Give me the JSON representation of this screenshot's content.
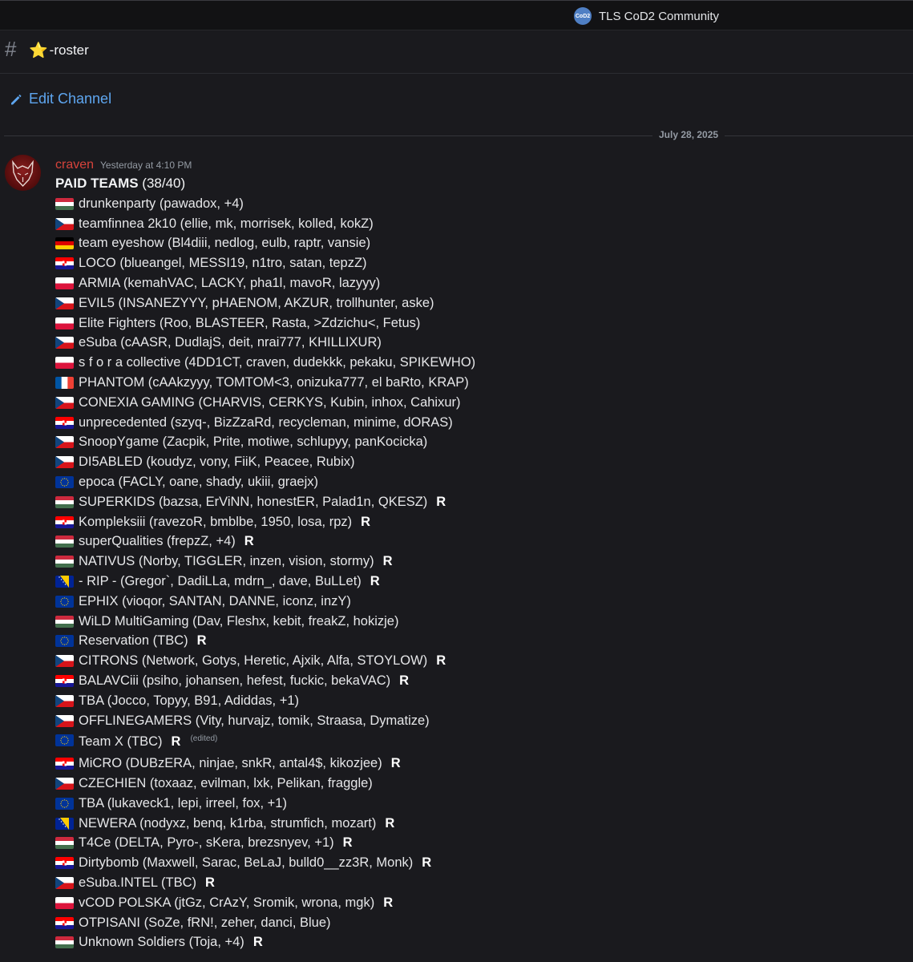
{
  "server": {
    "name": "TLS CoD2 Community",
    "icon_text": "CoD2"
  },
  "channel": {
    "hash_symbol": "#",
    "star": "⭐",
    "name": "-roster"
  },
  "edit_channel_label": "Edit Channel",
  "date_divider": "July 28, 2025",
  "message": {
    "author": "craven",
    "timestamp": "Yesterday at 4:10 PM",
    "title_bold": "PAID TEAMS",
    "title_count": " (38/40)",
    "r_mark": "R",
    "edited_label": "(edited)",
    "teams": [
      {
        "flag": "HU",
        "text": "drunkenparty (pawadox, +4)",
        "r": false
      },
      {
        "flag": "CZ",
        "text": "teamfinnea 2k10 (ellie, mk, morrisek, kolled, kokZ)",
        "r": false
      },
      {
        "flag": "DE",
        "text": "team eyeshow (Bl4diii, nedlog, eulb, raptr, vansie)",
        "r": false
      },
      {
        "flag": "HR",
        "text": "LOCO (blueangel, MESSI19, n1tro, satan, tepzZ)",
        "r": false
      },
      {
        "flag": "PL",
        "text": "ARMIA (kemahVAC, LACKY, pha1l, mavoR, lazyyy)",
        "r": false
      },
      {
        "flag": "CZ",
        "text": "EVIL5 (INSANEZYYY, pHAENOM, AKZUR, trollhunter, aske)",
        "r": false
      },
      {
        "flag": "PL",
        "text": "Elite Fighters (Roo, BLASTEER, Rasta, >Zdzichu<, Fetus)",
        "r": false
      },
      {
        "flag": "CZ",
        "text": "eSuba (cAASR, DudlajS, deit, nrai777, KHILLIXUR)",
        "r": false
      },
      {
        "flag": "PL",
        "text": "s f o r a collective (4DD1CT, craven, dudekkk, pekaku, SPIKEWHO)",
        "r": false
      },
      {
        "flag": "FR",
        "text": "PHANTOM (cAAkzyyy, TOMTOM<3, onizuka777, el baRto, KRAP)",
        "r": false
      },
      {
        "flag": "CZ",
        "text": "CONEXIA GAMING (CHARVIS, CERKYS, Kubin, inhox, Cahixur)",
        "r": false
      },
      {
        "flag": "HR",
        "text": "unprecedented (szyq-, BizZzaRd, recycleman, minime, dORAS)",
        "r": false
      },
      {
        "flag": "CZ",
        "text": "SnoopYgame (Zacpik, Prite, motiwe, schlupyy, panKocicka)",
        "r": false
      },
      {
        "flag": "CZ",
        "text": "DI5ABLED (koudyz, vony, FiiK, Peacee, Rubix)",
        "r": false
      },
      {
        "flag": "EU",
        "text": "epoca (FACLY, oane, shady, ukiii, graejx)",
        "r": false
      },
      {
        "flag": "HU",
        "text": "SUPERKIDS (bazsa, ErViNN, honestER, Palad1n, QKESZ)",
        "r": true
      },
      {
        "flag": "HR",
        "text": "Kompleksiii (ravezoR, bmblbe, 1950, losa, rpz)",
        "r": true
      },
      {
        "flag": "HU",
        "text": "superQualities (frepzZ, +4)",
        "r": true
      },
      {
        "flag": "HU",
        "text": "NATIVUS (Norby, TIGGLER, inzen, vision, stormy)",
        "r": true
      },
      {
        "flag": "BA",
        "text": "- RIP - (Gregor`, DadiLLa, mdrn_, dave, BuLLet)",
        "r": true
      },
      {
        "flag": "EU",
        "text": "EPHIX (vioqor, SANTAN, DANNE, iconz, inzY)",
        "r": false
      },
      {
        "flag": "HU",
        "text": "WiLD MultiGaming (Dav, Fleshx, kebit, freakZ, hokizje)",
        "r": false
      },
      {
        "flag": "EU",
        "text": "Reservation (TBC)",
        "r": true
      },
      {
        "flag": "CZ",
        "text": "CITRONS (Network, Gotys, Heretic, Ajxik, Alfa, STOYLOW)",
        "r": true
      },
      {
        "flag": "HR",
        "text": "BALAVCiii (psiho, johansen, hefest, fuckic, bekaVAC)",
        "r": true
      },
      {
        "flag": "CZ",
        "text": "TBA (Jocco, Topyy, B91, Adiddas, +1)",
        "r": false
      },
      {
        "flag": "CZ",
        "text": "OFFLINEGAMERS (Vity, hurvajz, tomik, Straasa, Dymatize)",
        "r": false
      },
      {
        "flag": "EU",
        "text": "Team X (TBC)",
        "r": true,
        "edited": true
      },
      {
        "flag": "HR",
        "text": "MiCRO (DUBzERA, ninjae, snkR, antal4$, kikozjee)",
        "r": true
      },
      {
        "flag": "CZ",
        "text": "CZECHIEN (toxaaz, evilman, lxk, Pelikan, fraggle)",
        "r": false
      },
      {
        "flag": "EU",
        "text": "TBA (lukaveck1, lepi,  irreel, fox, +1)",
        "r": false
      },
      {
        "flag": "BA",
        "text": "NEWERA (nodyxz, benq, k1rba, strumfich, mozart)",
        "r": true
      },
      {
        "flag": "HU",
        "text": "T4Ce (DELTA, Pyro-, sKera, brezsnyev, +1)",
        "r": true
      },
      {
        "flag": "HR",
        "text": "Dirtybomb (Maxwell, Sarac, BeLaJ, bulld0__zz3R, Monk)",
        "r": true
      },
      {
        "flag": "CZ",
        "text": "eSuba.INTEL (TBC)",
        "r": true
      },
      {
        "flag": "PL",
        "text": "vCOD POLSKA (jtGz, CrAzY, Sromik, wrona, mgk)",
        "r": true
      },
      {
        "flag": "HR",
        "text": "OTPISANI (SoZe, fRN!, zeher, danci, Blue)",
        "r": false
      },
      {
        "flag": "HU",
        "text": "Unknown Soldiers (Toja, +4)",
        "r": true
      }
    ]
  },
  "colors": {
    "background": "#1a1a1e",
    "author": "#d6433b",
    "link": "#5ea6f0",
    "muted": "#949ba4"
  }
}
